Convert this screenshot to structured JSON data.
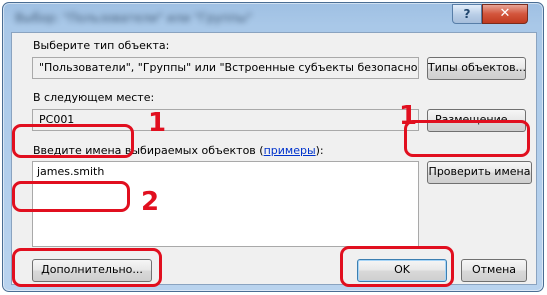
{
  "window": {
    "title": "Выбор: \"Пользователи\" или \"Группы\"",
    "help_glyph": "?",
    "close_glyph": "✕"
  },
  "object_type": {
    "label": "Выберите тип объекта:",
    "value": "\"Пользователи\", \"Группы\" или \"Встроенные субъекты безопасно",
    "button": "Типы объектов..."
  },
  "location": {
    "label": "В следующем месте:",
    "value": "PC001",
    "button": "Размещение..."
  },
  "names": {
    "label_prefix": "Введите ",
    "label_underlined": "и",
    "label_middle": "мена выбираемых объектов (",
    "label_link": "примеры",
    "label_suffix": "):",
    "value": "james.smith",
    "check_button": "Проверить имена"
  },
  "footer": {
    "advanced_button": "Дополнительно...",
    "ok_button": "OK",
    "cancel_button": "Отмена"
  },
  "annotations": {
    "step_one_left": "1",
    "step_one_right": "1",
    "step_two": "2"
  },
  "colors": {
    "annotation": "#e10f1f",
    "link": "#0033cc",
    "close_button": "#c03a20"
  }
}
